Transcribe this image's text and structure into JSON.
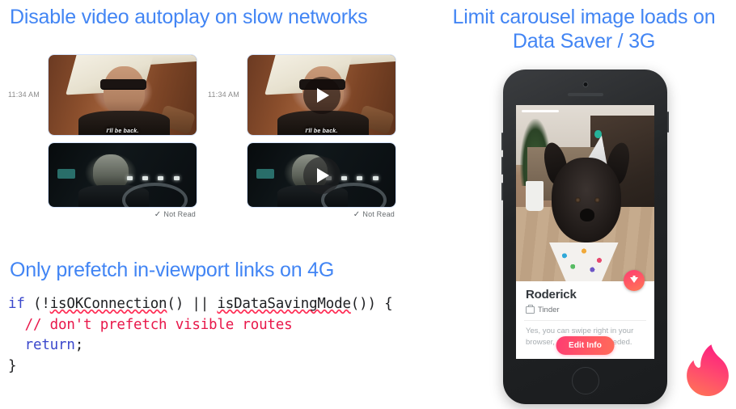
{
  "slide": {
    "headings": {
      "left_top": "Disable video autoplay on slow networks",
      "left_mid": "Only prefetch in-viewport links on 4G",
      "right": "Limit carousel image loads on Data Saver / 3G"
    },
    "accent_color": "#4285f4"
  },
  "chat_demos": [
    {
      "id": "autoplay-on",
      "timestamp": "11:34 AM",
      "caption": "I'll be back.",
      "status": "Not Read",
      "status_icon": "check-icon",
      "has_play_overlay": false
    },
    {
      "id": "autoplay-off",
      "timestamp": "11:34 AM",
      "caption": "I'll be back.",
      "status": "Not Read",
      "status_icon": "check-icon",
      "has_play_overlay": true
    }
  ],
  "code": {
    "language": "javascript",
    "lines": [
      [
        {
          "t": "if",
          "c": "kw"
        },
        {
          "t": " (!",
          "c": "pun"
        },
        {
          "t": "isOKConnection",
          "c": "fn"
        },
        {
          "t": "() || ",
          "c": "pun"
        },
        {
          "t": "isDataSavingMode",
          "c": "fn"
        },
        {
          "t": "()) {",
          "c": "pun"
        }
      ],
      [
        {
          "t": "  // don't prefetch visible routes",
          "c": "cmt"
        }
      ],
      [
        {
          "t": "  ",
          "c": "pun"
        },
        {
          "t": "return",
          "c": "kw"
        },
        {
          "t": ";",
          "c": "pun"
        }
      ],
      [
        {
          "t": "}",
          "c": "pun"
        }
      ]
    ],
    "colors": {
      "keyword": "#3b48cc",
      "comment": "#e8174a",
      "punctuation": "#202124",
      "spellcheck_underline": "#ff2d55"
    }
  },
  "phone": {
    "device": "iPhone",
    "card": {
      "name": "Roderick",
      "source_icon": "briefcase-icon",
      "source": "Tinder",
      "description": "Yes, you can swipe right in your browser, no app install needed.",
      "primary_button": "Edit Info",
      "download_badge_icon": "download-arrow-icon",
      "photo_alt": "french-bulldog-with-party-hat"
    },
    "brand_logo": "tinder-flame-icon",
    "brand_colors": {
      "pink": "#fe3c72",
      "orange": "#ff7854"
    }
  }
}
